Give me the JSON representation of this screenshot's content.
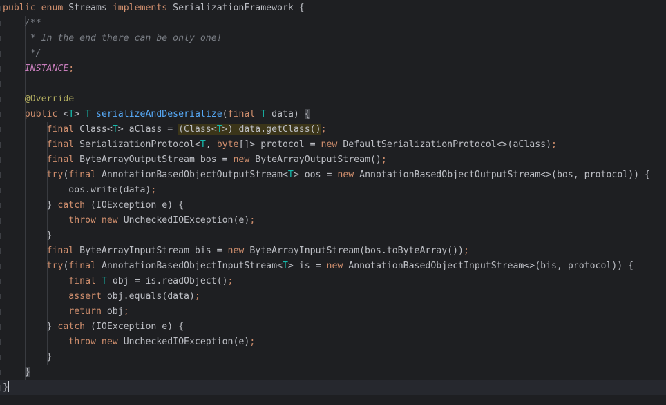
{
  "editor": {
    "language": "Java",
    "theme": "dark",
    "current_line": 25,
    "lines": [
      [
        [
          "kw",
          "public "
        ],
        [
          "kw",
          "enum "
        ],
        [
          "pl",
          "Streams "
        ],
        [
          "kw",
          "implements "
        ],
        [
          "pl",
          "SerializationFramework {"
        ]
      ],
      [
        [
          "pl",
          "    "
        ],
        [
          "cm",
          "/**"
        ]
      ],
      [
        [
          "pl",
          "    "
        ],
        [
          "cm",
          " * In the end there can be only one!"
        ]
      ],
      [
        [
          "pl",
          "    "
        ],
        [
          "cm",
          " */"
        ]
      ],
      [
        [
          "pl",
          "    "
        ],
        [
          "it",
          "INSTANCE"
        ],
        [
          "kw",
          ";"
        ]
      ],
      [],
      [
        [
          "pl",
          "    "
        ],
        [
          "an",
          "@Override"
        ]
      ],
      [
        [
          "pl",
          "    "
        ],
        [
          "kw",
          "public "
        ],
        [
          "pl",
          "<"
        ],
        [
          "tp",
          "T"
        ],
        [
          "pl",
          "> "
        ],
        [
          "tp",
          "T "
        ],
        [
          "fn",
          "serializeAndDeserialize"
        ],
        [
          "pl",
          "("
        ],
        [
          "kw",
          "final "
        ],
        [
          "tp",
          "T "
        ],
        [
          "pl",
          "data) "
        ],
        [
          "br",
          "{"
        ]
      ],
      [
        [
          "pl",
          "        "
        ],
        [
          "kw",
          "final "
        ],
        [
          "pl",
          "Class<"
        ],
        [
          "tp",
          "T"
        ],
        [
          "pl",
          "> aClass = "
        ],
        [
          "hl",
          "(Class<"
        ],
        [
          "tp hl",
          "T"
        ],
        [
          "hl",
          ">) data.getClass()"
        ],
        [
          "kw",
          ";"
        ]
      ],
      [
        [
          "pl",
          "        "
        ],
        [
          "kw",
          "final "
        ],
        [
          "pl",
          "SerializationProtocol<"
        ],
        [
          "tp",
          "T"
        ],
        [
          "pl",
          ", "
        ],
        [
          "kw",
          "byte"
        ],
        [
          "pl",
          "[]> protocol = "
        ],
        [
          "kw",
          "new "
        ],
        [
          "pl",
          "DefaultSerializationProtocol<>(aClass)"
        ],
        [
          "kw",
          ";"
        ]
      ],
      [
        [
          "pl",
          "        "
        ],
        [
          "kw",
          "final "
        ],
        [
          "pl",
          "ByteArrayOutputStream bos = "
        ],
        [
          "kw",
          "new "
        ],
        [
          "pl",
          "ByteArrayOutputStream()"
        ],
        [
          "kw",
          ";"
        ]
      ],
      [
        [
          "pl",
          "        "
        ],
        [
          "kw",
          "try"
        ],
        [
          "pl",
          "("
        ],
        [
          "kw",
          "final "
        ],
        [
          "pl",
          "AnnotationBasedObjectOutputStream<"
        ],
        [
          "tp",
          "T"
        ],
        [
          "pl",
          "> oos = "
        ],
        [
          "kw",
          "new "
        ],
        [
          "pl",
          "AnnotationBasedObjectOutputStream<>(bos, protocol)) {"
        ]
      ],
      [
        [
          "pl",
          "            oos.write(data)"
        ],
        [
          "kw",
          ";"
        ]
      ],
      [
        [
          "pl",
          "        } "
        ],
        [
          "kw",
          "catch "
        ],
        [
          "pl",
          "(IOException e) {"
        ]
      ],
      [
        [
          "pl",
          "            "
        ],
        [
          "kw",
          "throw "
        ],
        [
          "kw",
          "new "
        ],
        [
          "pl",
          "UncheckedIOException(e)"
        ],
        [
          "kw",
          ";"
        ]
      ],
      [
        [
          "pl",
          "        }"
        ]
      ],
      [
        [
          "pl",
          "        "
        ],
        [
          "kw",
          "final "
        ],
        [
          "pl",
          "ByteArrayInputStream bis = "
        ],
        [
          "kw",
          "new "
        ],
        [
          "pl",
          "ByteArrayInputStream(bos.toByteArray())"
        ],
        [
          "kw",
          ";"
        ]
      ],
      [
        [
          "pl",
          "        "
        ],
        [
          "kw",
          "try"
        ],
        [
          "pl",
          "("
        ],
        [
          "kw",
          "final "
        ],
        [
          "pl",
          "AnnotationBasedObjectInputStream<"
        ],
        [
          "tp",
          "T"
        ],
        [
          "pl",
          "> is = "
        ],
        [
          "kw",
          "new "
        ],
        [
          "pl",
          "AnnotationBasedObjectInputStream<>(bis, protocol)) {"
        ]
      ],
      [
        [
          "pl",
          "            "
        ],
        [
          "kw",
          "final "
        ],
        [
          "tp",
          "T "
        ],
        [
          "pl",
          "obj = is.readObject()"
        ],
        [
          "kw",
          ";"
        ]
      ],
      [
        [
          "pl",
          "            "
        ],
        [
          "kw",
          "assert "
        ],
        [
          "pl",
          "obj.equals(data)"
        ],
        [
          "kw",
          ";"
        ]
      ],
      [
        [
          "pl",
          "            "
        ],
        [
          "kw",
          "return "
        ],
        [
          "pl",
          "obj"
        ],
        [
          "kw",
          ";"
        ]
      ],
      [
        [
          "pl",
          "        } "
        ],
        [
          "kw",
          "catch "
        ],
        [
          "pl",
          "(IOException e) {"
        ]
      ],
      [
        [
          "pl",
          "            "
        ],
        [
          "kw",
          "throw "
        ],
        [
          "kw",
          "new "
        ],
        [
          "pl",
          "UncheckedIOException(e)"
        ],
        [
          "kw",
          ";"
        ]
      ],
      [
        [
          "pl",
          "        }"
        ]
      ],
      [
        [
          "pl",
          "    "
        ],
        [
          "br",
          "}"
        ]
      ],
      [
        [
          "pl",
          "}"
        ]
      ]
    ]
  }
}
